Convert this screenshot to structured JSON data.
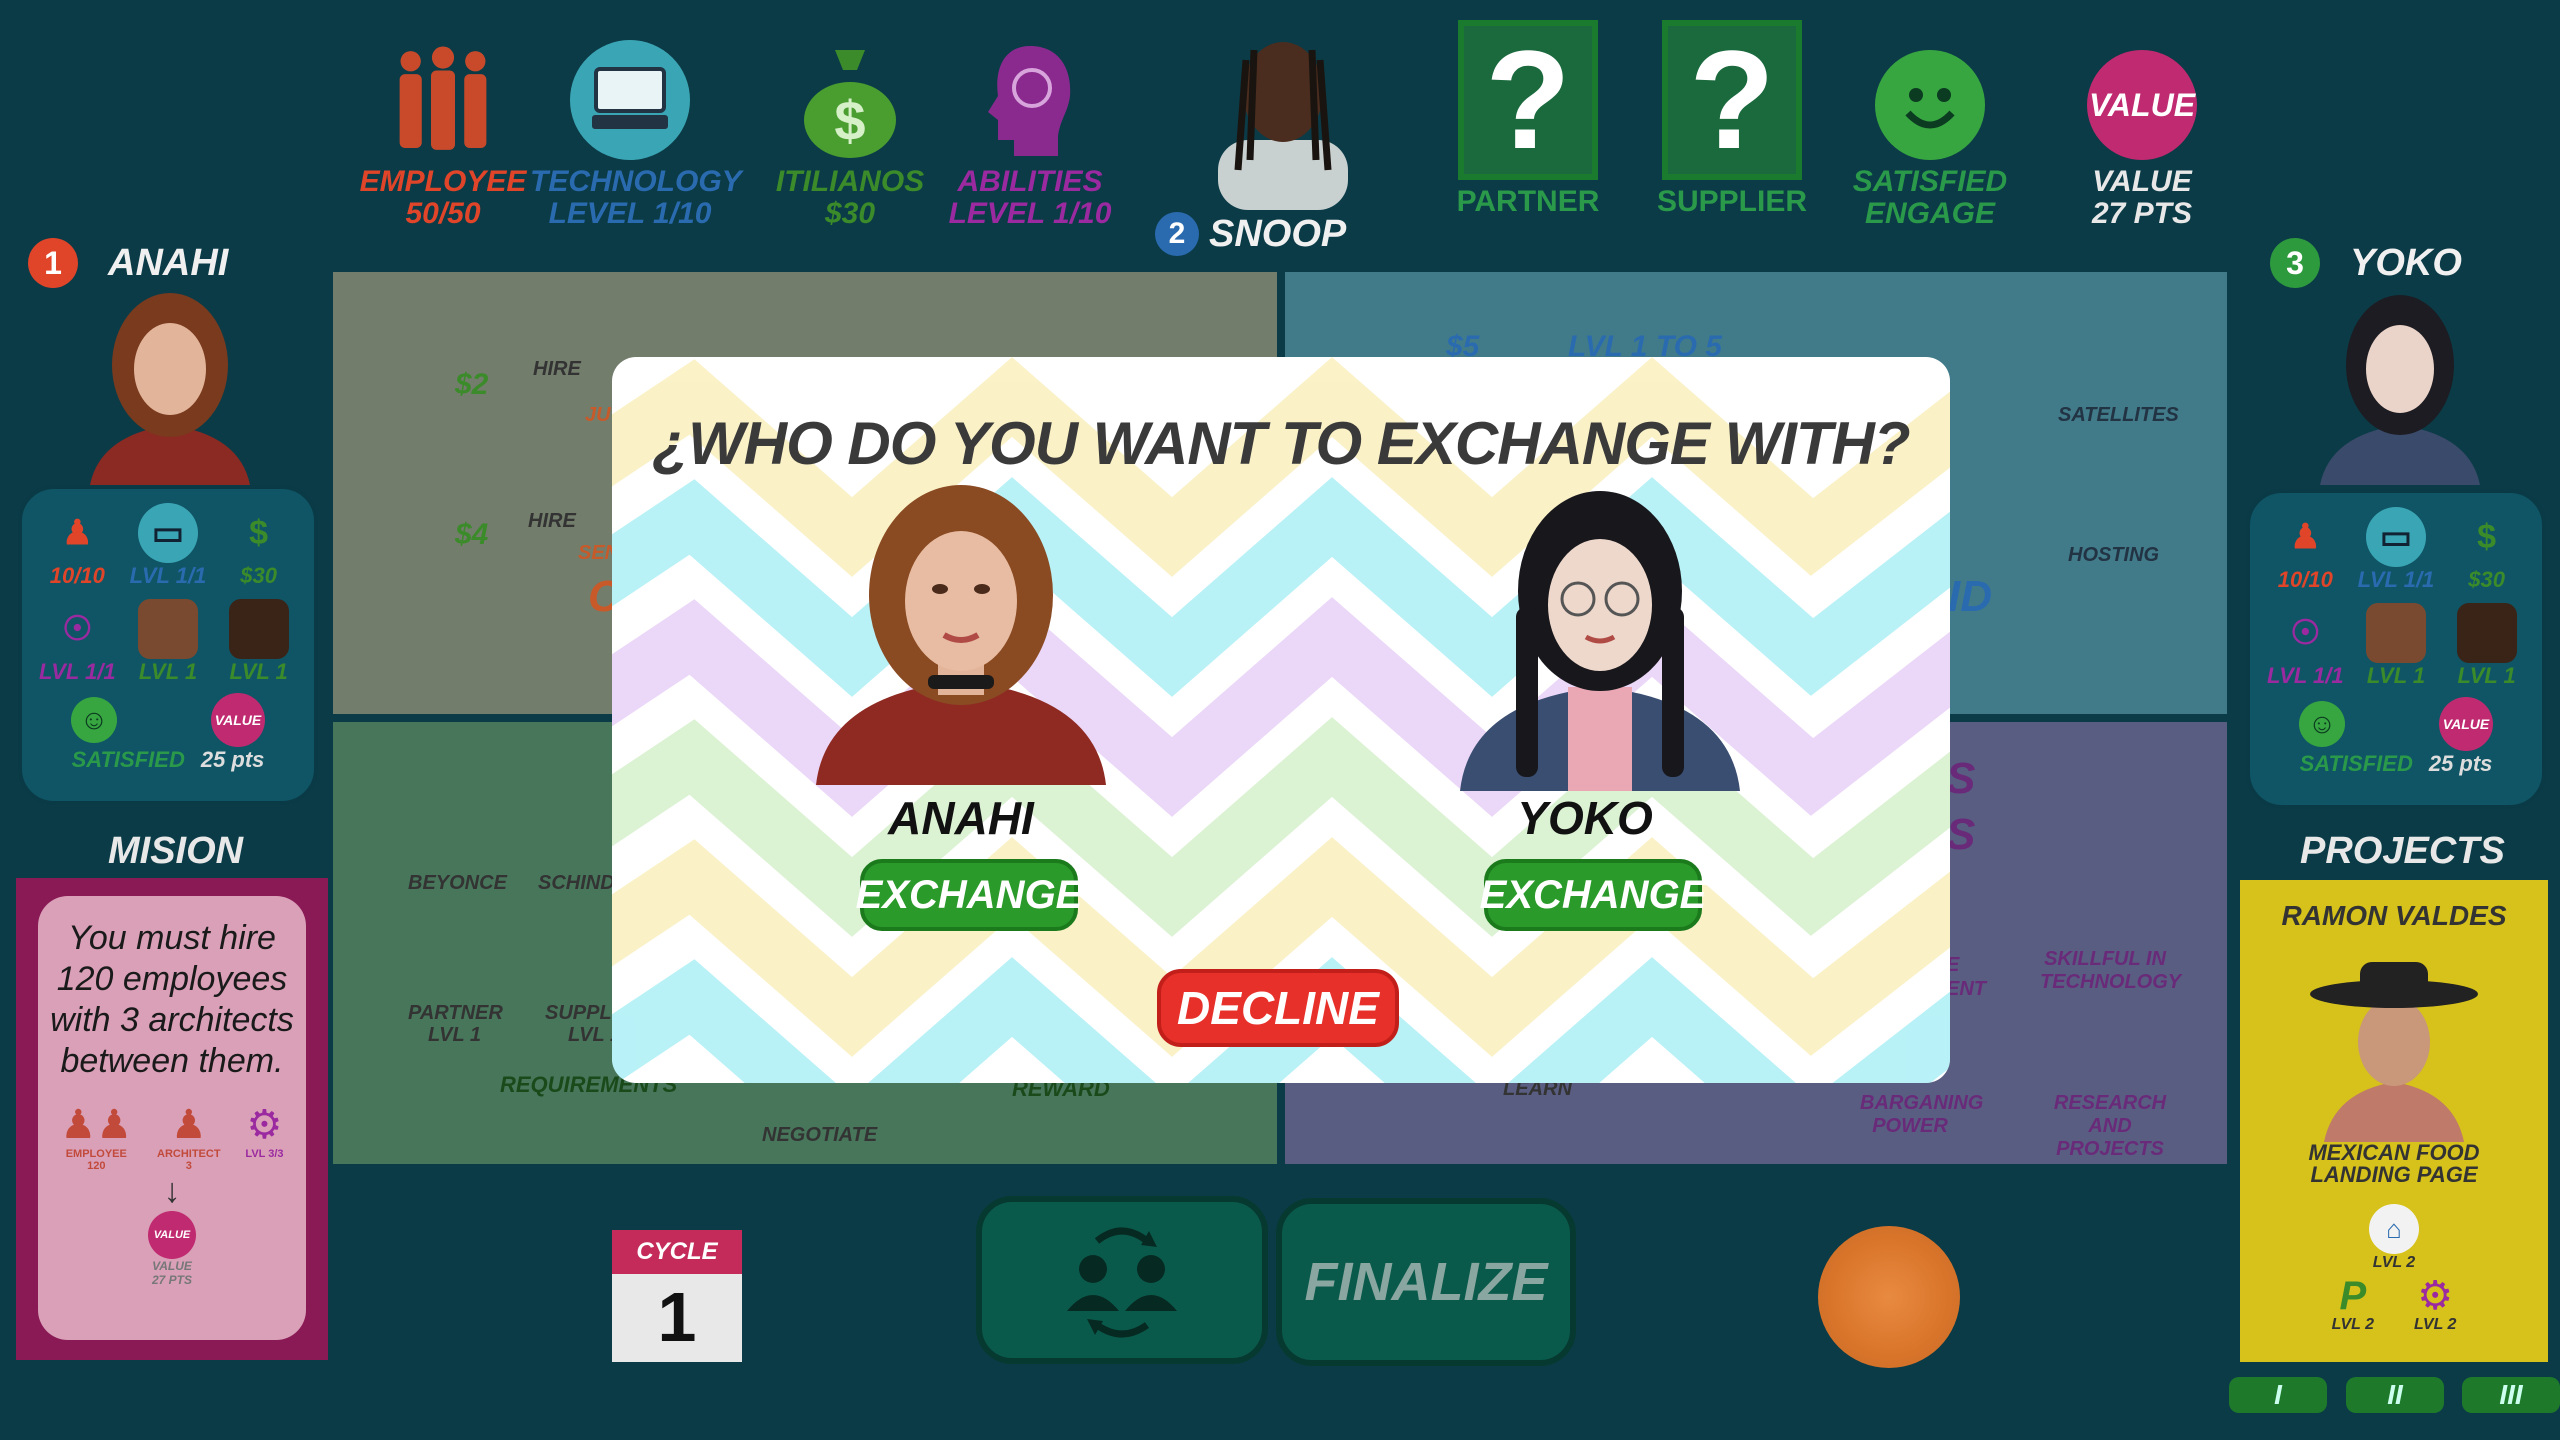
{
  "top_bar": {
    "employee": {
      "icon": "employees-icon",
      "label": "EMPLOYEE",
      "value": "50/50",
      "color": "#e0452a"
    },
    "technology": {
      "icon": "computer-icon",
      "label": "TECHNOLOGY",
      "value": "LEVEL  1/10",
      "color": "#2a6bb0"
    },
    "itilianos": {
      "icon": "money-bag-icon",
      "label": "ITILIANOS",
      "value": "$30",
      "color": "#3b8b2a"
    },
    "abilities": {
      "icon": "brain-head-icon",
      "label": "ABILITIES",
      "value": "LEVEL  1/10",
      "color": "#9b2aa0"
    },
    "current_player": {
      "badge": "2",
      "name": "SNOOP"
    },
    "partner": {
      "icon": "question-icon",
      "label": "PARTNER"
    },
    "supplier": {
      "icon": "question-icon",
      "label": "SUPPLIER"
    },
    "satisfied": {
      "icon": "smiley-icon",
      "label": "SATISFIED",
      "sub": "ENGAGE"
    },
    "value": {
      "icon": "value-icon",
      "badge_text": "VALUE",
      "label": "VALUE",
      "sub": "27 PTS"
    }
  },
  "left_player": {
    "badge": "1",
    "name": "ANAHI",
    "stats": {
      "employees": "10/10",
      "tech": "LVL 1/1",
      "money": "$30",
      "abilities": "LVL 1/1",
      "partner": "LVL 1",
      "supplier": "LVL 1",
      "satisfied": "SATISFIED",
      "value_badge": "VALUE",
      "value": "25 pts"
    }
  },
  "right_player": {
    "badge": "3",
    "name": "YOKO",
    "stats": {
      "employees": "10/10",
      "tech": "LVL 1/1",
      "money": "$30",
      "abilities": "LVL 1/1",
      "partner": "LVL 1",
      "supplier": "LVL 1",
      "satisfied": "SATISFIED",
      "value_badge": "VALUE",
      "value": "25 pts"
    }
  },
  "mission": {
    "heading": "MISION",
    "text": "You must hire 120 employees with 3 architects between them.",
    "employee_label": "EMPLOYEE",
    "employee_count": "120",
    "architect_label": "ARCHITECT",
    "architect_count": "3",
    "level_label": "LVL 3/3",
    "value_badge": "VALUE",
    "value_label": "VALUE",
    "value_pts": "27 PTS"
  },
  "projects": {
    "heading": "PROJECTS",
    "card_title": "RAMON VALDES",
    "card_subtitle": "MEXICAN FOOD LANDING PAGE",
    "req1": "LVL 2",
    "req2": "LVL 2",
    "req3": "LVL 2",
    "tabs": [
      "I",
      "II",
      "III"
    ]
  },
  "board": {
    "hire_label": "HIRE",
    "cost_a": "$2",
    "cost_b": "$4",
    "cost_c": "$5",
    "level_text": "LVL 1 TO 5",
    "satellites": "SATELLITES",
    "hosting": "HOSTING",
    "partner_name": "BEYONCE",
    "partner_sub": "PARTNER",
    "partner_lvl": "LVL 1",
    "supplier_name": "SCHINDL",
    "supplier_sub": "SUPPLI",
    "supplier_lvl": "LVL 1",
    "requirements": "REQUIREMENTS",
    "reward": "REWARD",
    "negotiate": "NEGOTIATE",
    "learn": "LEARN",
    "barganing": "BARGANING POWER",
    "skillful": "SKILLFUL IN TECHNOLOGY",
    "research": "RESEARCH AND PROJECTS",
    "frag_ju": "JU",
    "frag_sen": "SEN",
    "frag_c": "C",
    "frag_id": "ID",
    "frag_s1": "S",
    "frag_s2": "S",
    "frag_ent": "ENT",
    "frag_e": "E"
  },
  "modal": {
    "title": "¿WHO DO YOU WANT TO EXCHANGE WITH?",
    "option1_name": "ANAHI",
    "option1_button": "EXCHANGE",
    "option2_name": "YOKO",
    "option2_button": "EXCHANGE",
    "decline": "DECLINE"
  },
  "bottom": {
    "cycle_label": "CYCLE",
    "cycle_value": "1",
    "exchange_icon": "exchange-users-icon",
    "finalize": "FINALIZE"
  }
}
